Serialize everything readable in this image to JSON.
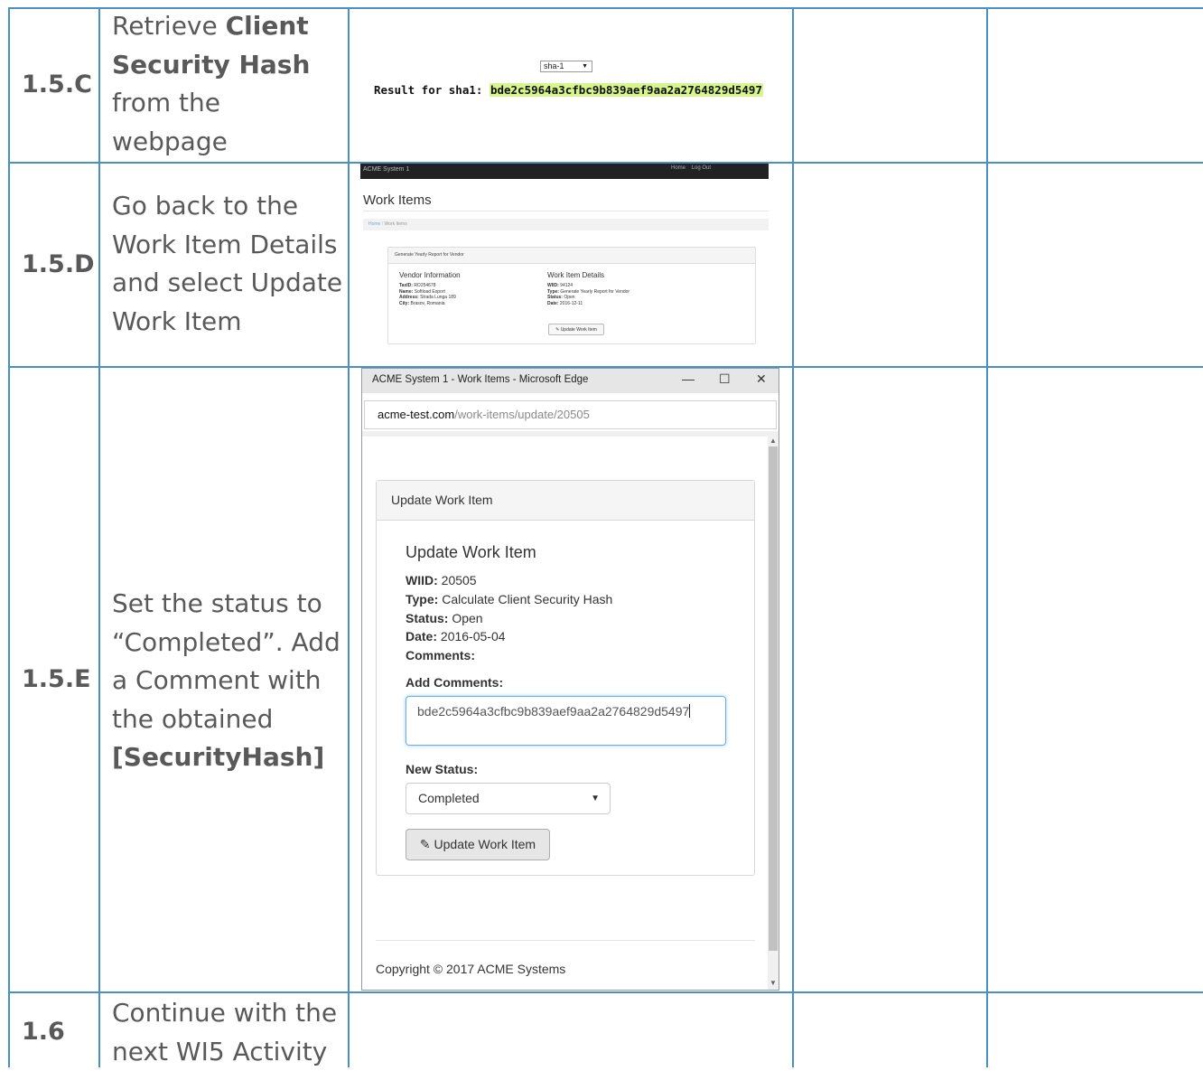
{
  "rows": [
    {
      "step": "1.5.C",
      "desc_html": "Retrieve <b>Client Security Hash</b> from the webpage"
    },
    {
      "step": "1.5.D",
      "desc_html": "Go back to the Work Item Details and select Update Work Item"
    },
    {
      "step": "1.5.E",
      "desc_html": "Set the status to “Completed”. Add a Comment with the obtained <b>[SecurityHash]</b>"
    },
    {
      "step": "1.6",
      "desc_html": "Continue with the next WI5 Activity"
    }
  ],
  "hash_page": {
    "select_value": "sha-1",
    "result_label": "Result for sha1:",
    "result_hash": "bde2c5964a3cfbc9b839aef9aa2a2764829d5497"
  },
  "details_shot": {
    "brand": "ACME System 1",
    "nav_home": "Home",
    "nav_logout": "Log Out",
    "heading": "Work Items",
    "crumb_home": "Home",
    "crumb_current": "Work Items",
    "panel_title": "Generate Yearly Report for Vendor",
    "vendor_title": "Vendor Information",
    "vendor": [
      {
        "k": "TaxID:",
        "v": "RO254678"
      },
      {
        "k": "Name:",
        "v": "Softload Export"
      },
      {
        "k": "Address:",
        "v": "Strada Lunga 189"
      },
      {
        "k": "City:",
        "v": "Brasov, Romania"
      }
    ],
    "details_title": "Work Item Details",
    "details": [
      {
        "k": "WIID:",
        "v": "94124"
      },
      {
        "k": "Type:",
        "v": "Generate Yearly Report for Vendor"
      },
      {
        "k": "Status:",
        "v": "Open"
      },
      {
        "k": "Date:",
        "v": "2016-12-11"
      }
    ],
    "button": "✎ Update Work Item"
  },
  "edge": {
    "window_title": "ACME System 1 - Work Items - Microsoft Edge",
    "minimize": "—",
    "maximize": "☐",
    "close": "✕",
    "url_host": "acme-test.com",
    "url_path": "/work-items/update/20505",
    "card_head": "Update Work Item",
    "card_title": "Update Work Item",
    "wiid_label": "WIID:",
    "wiid": "20505",
    "type_label": "Type:",
    "type": "Calculate Client Security Hash",
    "status_label": "Status:",
    "status": "Open",
    "date_label": "Date:",
    "date": "2016-05-04",
    "comments_label": "Comments:",
    "add_comments_label": "Add Comments:",
    "comment_value": "bde2c5964a3cfbc9b839aef9aa2a2764829d5497",
    "new_status_label": "New Status:",
    "new_status_value": "Completed",
    "update_button": "✎ Update Work Item",
    "footer": "Copyright © 2017 ACME Systems"
  }
}
